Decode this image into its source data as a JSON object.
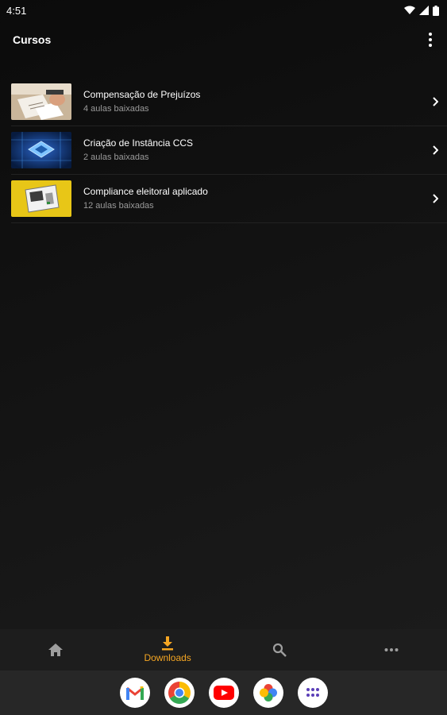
{
  "status_bar": {
    "time": "4:51"
  },
  "header": {
    "title": "Cursos",
    "menu_icon": "more-vert-icon"
  },
  "courses": [
    {
      "title": "Compensação de Prejuízos",
      "subtitle": "4 aulas baixadas",
      "thumbnail": "office-paperwork-image"
    },
    {
      "title": "Criação de Instância CCS",
      "subtitle": "2 aulas baixadas",
      "thumbnail": "circuit-chip-image"
    },
    {
      "title": "Compliance eleitoral aplicado",
      "subtitle": "12 aulas baixadas",
      "thumbnail": "ballot-box-image"
    }
  ],
  "bottom_nav": {
    "active": "downloads",
    "items": [
      {
        "id": "home",
        "icon": "home-icon",
        "label": ""
      },
      {
        "id": "downloads",
        "icon": "download-icon",
        "label": "Downloads"
      },
      {
        "id": "search",
        "icon": "search-icon",
        "label": ""
      },
      {
        "id": "more",
        "icon": "more-horiz-icon",
        "label": ""
      }
    ]
  },
  "dock": [
    "gmail-icon",
    "chrome-icon",
    "youtube-icon",
    "photos-icon",
    "app-drawer-icon"
  ],
  "colors": {
    "accent": "#f5a623",
    "background": "#101010",
    "nav": "#1d1d1d"
  }
}
